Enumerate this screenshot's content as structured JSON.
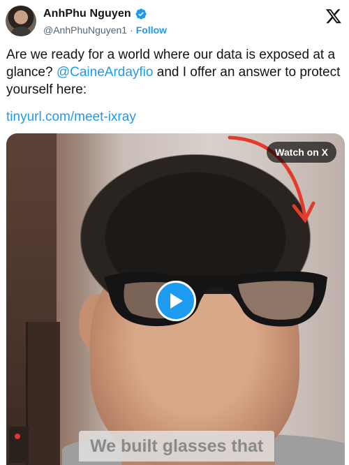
{
  "author": {
    "name": "AnhPhu Nguyen",
    "handle": "@AnhPhuNguyen1",
    "separator": "·",
    "follow_label": "Follow",
    "verified": true
  },
  "tweet": {
    "text_before_mention": "Are we ready for a world where our data is exposed at a glance? ",
    "mention": "@CaineArdayfio",
    "text_after_mention": " and I offer an answer to protect yourself here:",
    "link": "tinyurl.com/meet-ixray"
  },
  "media": {
    "watch_label": "Watch on X",
    "caption": "We built glasses that",
    "icons": {
      "play": "play-icon",
      "logo": "x-logo-icon",
      "verified": "verified-badge-icon"
    }
  },
  "colors": {
    "accent": "#1d9bf0",
    "text": "#0f1419",
    "secondary": "#536471"
  }
}
